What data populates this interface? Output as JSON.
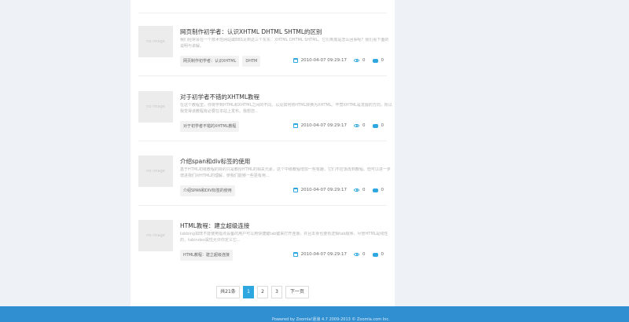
{
  "articles": [
    {
      "title": "网页制作初学者：认识XHTML DHTML SHTML的区别",
      "thumb_label": "no image",
      "desc": "我们经常会在一个技术性网站或BBS见到这三个东东：XHTML DHTML SHTML。它们到底是怎么回事呢？我们看下面的说明与讲解。",
      "tags": [
        "网页制作初学者：认识XHTML",
        "DHTM"
      ],
      "date": "2010-04-07 09:29:17",
      "views": "0",
      "comments": "0"
    },
    {
      "title": "对于初学者不错的XHTML教程",
      "thumb_label": "no image",
      "desc": "在这个教程里，你将学到HTML和XHTML之间的不同。以及如何将HTML转换为XHTML。毕竟XHTML是发展的方向，所以我觉得该教程有必要在本站上发布。我想您...",
      "tags": [
        "对于初学者不错的XHTML教程"
      ],
      "date": "2010-04-07 09:29:17",
      "views": "0",
      "comments": "0"
    },
    {
      "title": "介绍span和div标签的使用",
      "thumb_label": "no image",
      "desc": "基于HTML初级教程的目的只是教授HTML的相关元素，这个中级教程增加一些有趣，它们不应该再到教程。但可以进一步增进我们对HTML的理解，使我们能够一些更有用...",
      "tags": [
        "介绍SPAN和DIV标签的使用"
      ],
      "date": "2010-04-07 09:29:17",
      "views": "0",
      "comments": "0"
    },
    {
      "title": "HTML教程：建立超级连接",
      "thumb_label": "no image",
      "desc": "tabbing如既不能使用指点设备的用户可以用快捷键tab键来打开连接，并且本身也要有逻辑tab顺序。尽管HTML是线性的，tabindex属性允许你定义它...",
      "tags": [
        "HTML教程：建立超级连接"
      ],
      "date": "2010-04-07 09:29:17",
      "views": "0",
      "comments": "0"
    }
  ],
  "pagination": {
    "total": "共21条",
    "pages": [
      "1",
      "2",
      "3"
    ],
    "active": "1",
    "next": "下一页"
  },
  "footer": {
    "text": "Powered by Zoomla!逐浪 4.7 2009-2013 © Zoomla.com Inc."
  },
  "colors": {
    "accent": "#2ea7e0",
    "footer_bg": "#2f8fd1",
    "page_bg": "#eef2f6"
  }
}
